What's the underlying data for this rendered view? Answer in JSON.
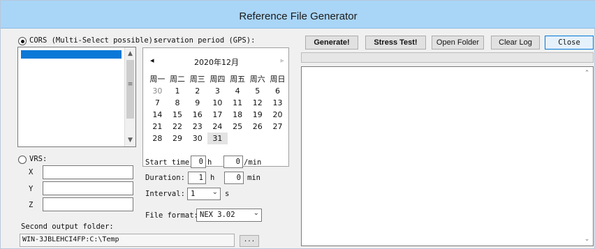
{
  "window": {
    "title": "Reference File Generator"
  },
  "left": {
    "cors_label": "CORS (Multi-Select possible):",
    "observation_label": "servation period (GPS):",
    "vrs_label": "VRS:",
    "x_label": "X",
    "y_label": "Y",
    "z_label": "Z",
    "second_output_label": "Second output folder:",
    "second_output_value": "WIN-3JBLEHCI4FP:C:\\Temp",
    "browse_label": "..."
  },
  "calendar": {
    "month_label": "2020年12月",
    "prev_icon": "◂",
    "next_icon": "▸",
    "weekdays": [
      "周一",
      "周二",
      "周三",
      "周四",
      "周五",
      "周六",
      "周日"
    ],
    "weeks": [
      [
        "30",
        "1",
        "2",
        "3",
        "4",
        "5",
        "6"
      ],
      [
        "7",
        "8",
        "9",
        "10",
        "11",
        "12",
        "13"
      ],
      [
        "14",
        "15",
        "16",
        "17",
        "18",
        "19",
        "20"
      ],
      [
        "21",
        "22",
        "23",
        "24",
        "25",
        "26",
        "27"
      ],
      [
        "28",
        "29",
        "30",
        "31"
      ]
    ],
    "today": "31"
  },
  "timing": {
    "start_label": "Start time:",
    "start_h": "0",
    "h_unit": "h",
    "start_min": "0",
    "min_unit": "/min",
    "duration_label": "Duration:",
    "duration_h": "1",
    "duration_h_unit": "h",
    "duration_min": "0",
    "duration_min_unit": "min",
    "interval_label": "Interval:",
    "interval_value": "1",
    "interval_unit": "s",
    "format_label": "File format:",
    "format_value": "NEX 3.02"
  },
  "toolbar": {
    "generate": "Generate!",
    "stress": "Stress Test!",
    "open_folder": "Open Folder",
    "clear_log": "Clear Log",
    "close": "Close"
  }
}
